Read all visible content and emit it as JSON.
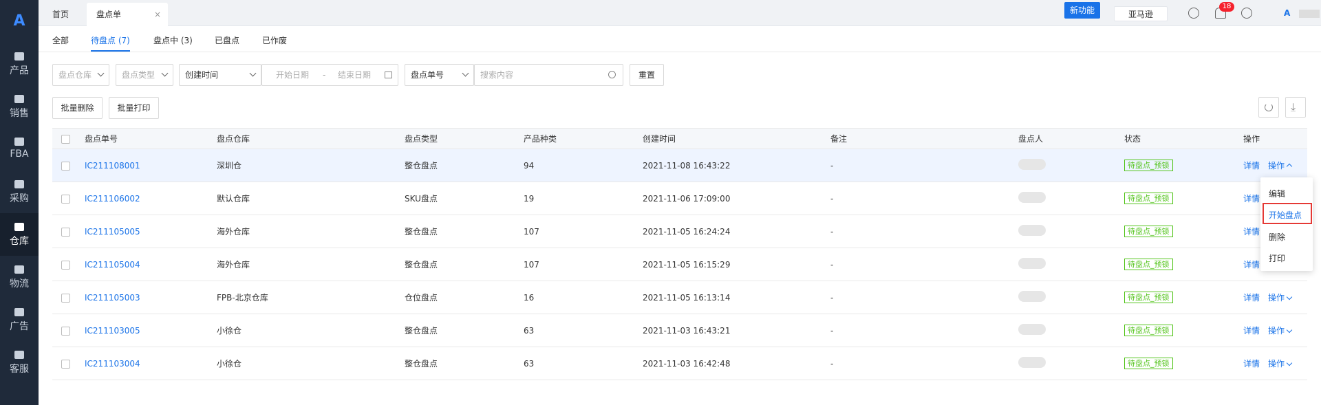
{
  "sidebar": {
    "logo": "A",
    "items": [
      {
        "label": "产品",
        "icon": "bag-icon"
      },
      {
        "label": "销售",
        "icon": "sale-icon"
      },
      {
        "label": "FBA",
        "icon": "fba-icon"
      },
      {
        "label": "采购",
        "icon": "cart-icon"
      },
      {
        "label": "仓库",
        "icon": "warehouse-icon"
      },
      {
        "label": "物流",
        "icon": "truck-icon"
      },
      {
        "label": "广告",
        "icon": "ad-icon"
      },
      {
        "label": "客服",
        "icon": "mail-icon"
      }
    ],
    "active": "仓库"
  },
  "topbar": {
    "tabs": [
      {
        "label": "首页"
      },
      {
        "label": "盘点单"
      }
    ],
    "close": "×",
    "new_feature": "新功能",
    "marketplace": "亚马逊",
    "notification_count": "18"
  },
  "subtabs": [
    "全部",
    "待盘点 (7)",
    "盘点中 (3)",
    "已盘点",
    "已作废"
  ],
  "filters": {
    "warehouse": "盘点仓库",
    "type": "盘点类型",
    "time_field": "创建时间",
    "start_date": "开始日期",
    "sep": "-",
    "end_date": "结束日期",
    "search_field": "盘点单号",
    "search_placeholder": "搜索内容",
    "reset": "重置"
  },
  "actions": {
    "batch_delete": "批量删除",
    "batch_print": "批量打印"
  },
  "table": {
    "headers": [
      "盘点单号",
      "盘点仓库",
      "盘点类型",
      "产品种类",
      "创建时间",
      "备注",
      "盘点人",
      "状态",
      "操作"
    ],
    "rows": [
      {
        "no": "IC211108001",
        "warehouse": "深圳仓",
        "type": "整仓盘点",
        "kinds": "94",
        "time": "2021-11-08 16:43:22",
        "note": "-",
        "status": "待盘点_预锁"
      },
      {
        "no": "IC211106002",
        "warehouse": "默认仓库",
        "type": "SKU盘点",
        "kinds": "19",
        "time": "2021-11-06 17:09:00",
        "note": "-",
        "status": "待盘点_预锁"
      },
      {
        "no": "IC211105005",
        "warehouse": "海外仓库",
        "type": "整仓盘点",
        "kinds": "107",
        "time": "2021-11-05 16:24:24",
        "note": "-",
        "status": "待盘点_预锁"
      },
      {
        "no": "IC211105004",
        "warehouse": "海外仓库",
        "type": "整仓盘点",
        "kinds": "107",
        "time": "2021-11-05 16:15:29",
        "note": "-",
        "status": "待盘点_预锁"
      },
      {
        "no": "IC211105003",
        "warehouse": "FPB-北京仓库",
        "type": "仓位盘点",
        "kinds": "16",
        "time": "2021-11-05 16:13:14",
        "note": "-",
        "status": "待盘点_预锁"
      },
      {
        "no": "IC211103005",
        "warehouse": "小徐仓",
        "type": "整仓盘点",
        "kinds": "63",
        "time": "2021-11-03 16:43:21",
        "note": "-",
        "status": "待盘点_预锁"
      },
      {
        "no": "IC211103004",
        "warehouse": "小徐仓",
        "type": "整仓盘点",
        "kinds": "63",
        "time": "2021-11-03 16:42:48",
        "note": "-",
        "status": "待盘点_预锁"
      }
    ],
    "detail": "详情",
    "ops": "操作"
  },
  "dropdown": [
    "编辑",
    "开始盘点",
    "删除",
    "打印"
  ]
}
